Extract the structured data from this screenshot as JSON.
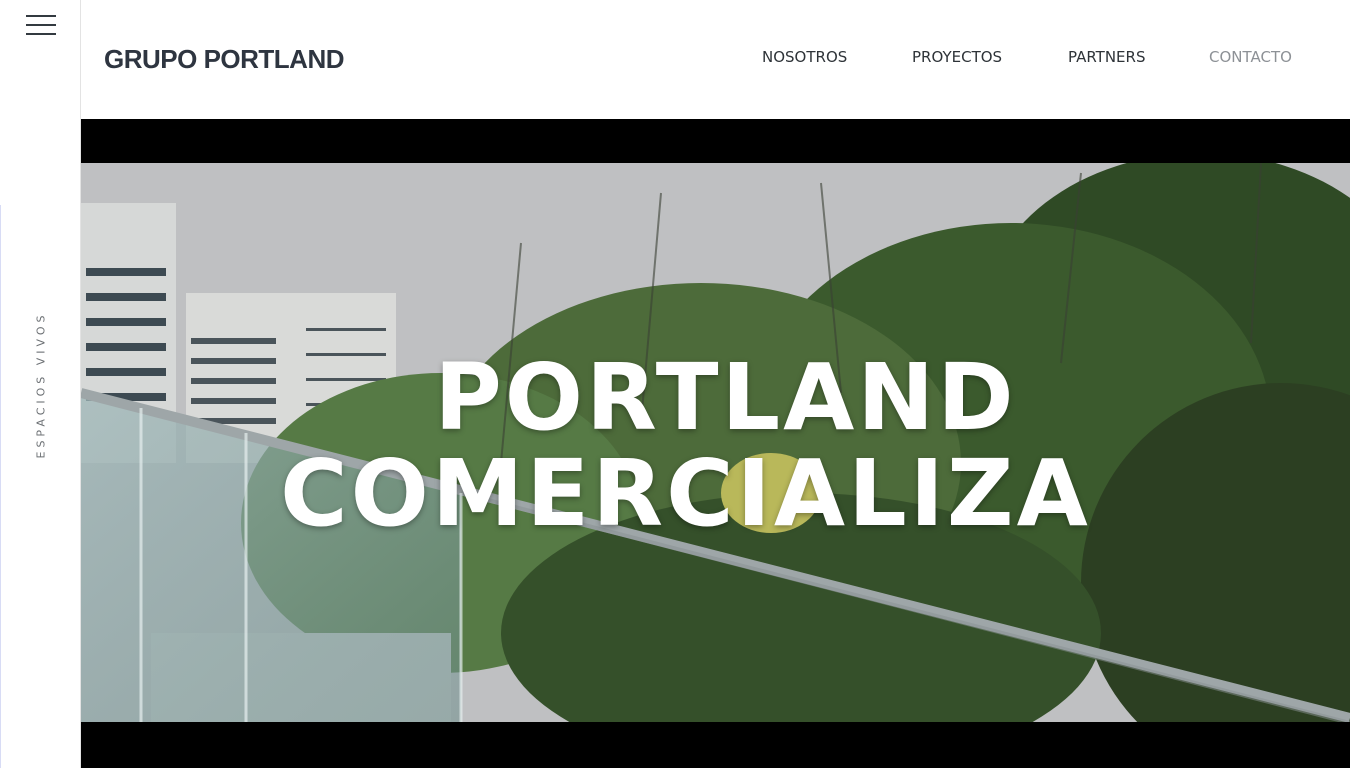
{
  "sidebar": {
    "menu_icon": "hamburger-icon",
    "tagline": "ESPACIOS VIVOS"
  },
  "header": {
    "logo": "GRUPO PORTLAND",
    "nav": [
      {
        "label": "NOSOTROS"
      },
      {
        "label": "PROYECTOS"
      },
      {
        "label": "PARTNERS"
      },
      {
        "label": "CONTACTO",
        "muted": true
      }
    ]
  },
  "hero": {
    "headline_line1": "PORTLAND",
    "headline_line2": "COMERCIALIZA"
  },
  "colors": {
    "text_dark": "#2e3540",
    "nav_muted": "#8d9196",
    "letterbox": "#000000",
    "headline": "#ffffff"
  }
}
